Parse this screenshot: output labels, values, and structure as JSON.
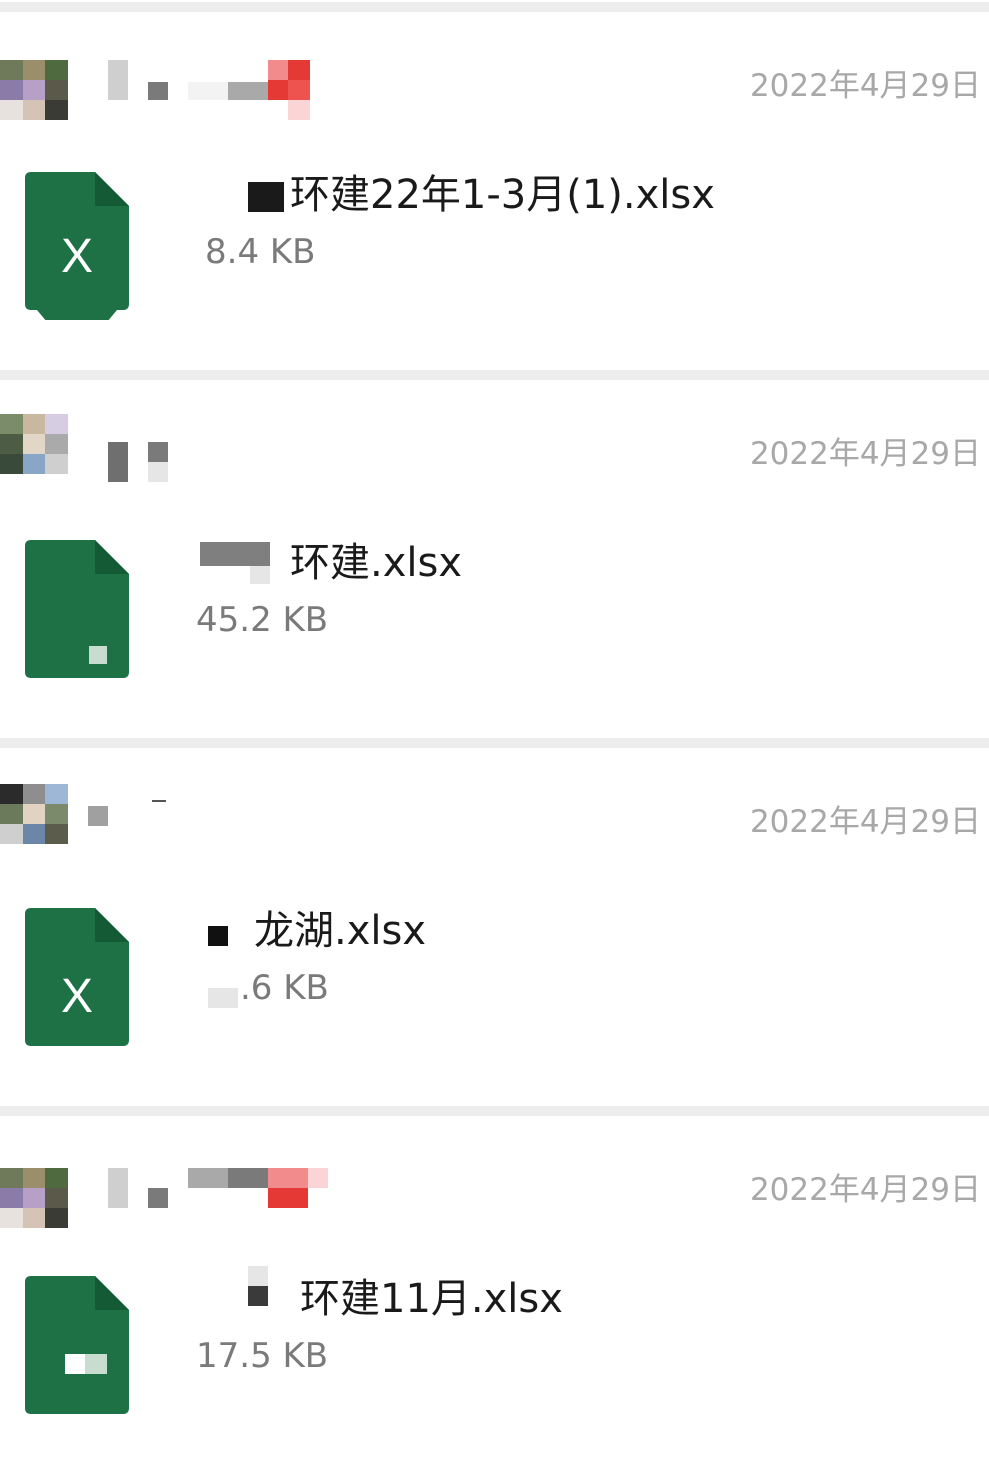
{
  "colors": {
    "excel_green": "#1e7145",
    "date_gray": "#a8a8a8",
    "divider": "#ededed"
  },
  "files": [
    {
      "date": "2022年4月29日",
      "name": "环建22年1-3月(1).xlsx",
      "size": "8.4 KB",
      "icon": "excel-file-icon"
    },
    {
      "date": "2022年4月29日",
      "name": "环建.xlsx",
      "size": "45.2 KB",
      "icon": "excel-file-icon"
    },
    {
      "date": "2022年4月29日",
      "name": "龙湖.xlsx",
      "size": ".6 KB",
      "icon": "excel-file-icon"
    },
    {
      "date": "2022年4月29日",
      "name": "环建11月.xlsx",
      "size": "17.5 KB",
      "icon": "excel-file-icon"
    }
  ]
}
